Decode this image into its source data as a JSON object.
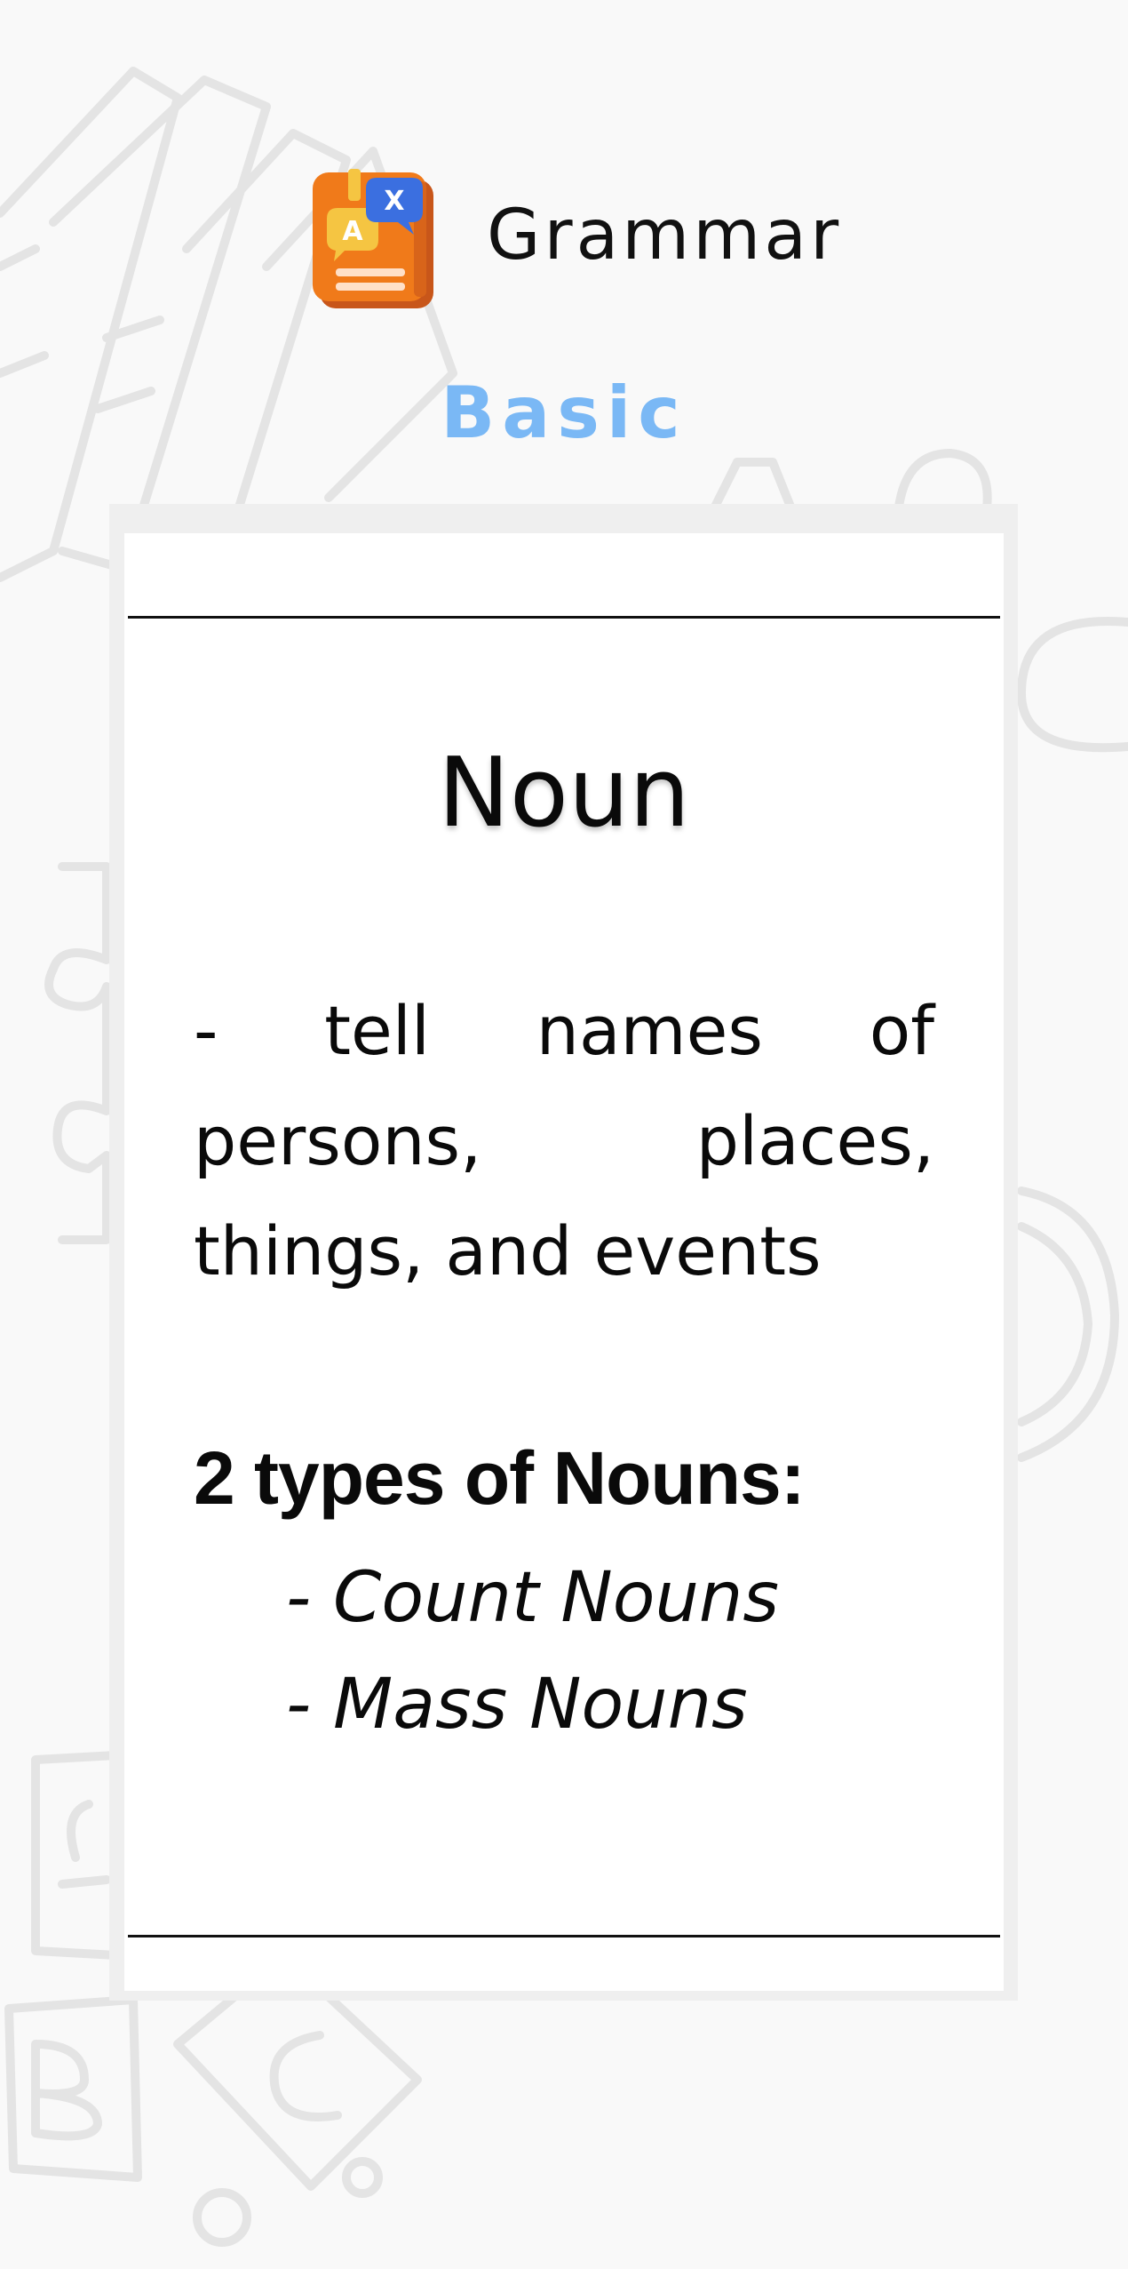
{
  "app": {
    "title": "Grammar",
    "logo_icon": "grammar-book-icon",
    "logo_letters": {
      "a": "A",
      "x": "X"
    },
    "level": "Basic"
  },
  "lesson": {
    "term": "Noun",
    "definition": "- tell names of persons, places, things, and events",
    "types_heading": "2 types of Nouns:",
    "types": [
      "- Count Nouns",
      "- Mass Nouns"
    ]
  },
  "colors": {
    "background": "#f9f9f9",
    "card": "#ffffff",
    "accent_level": "#7ab8f5",
    "logo_book": "#f07a1a",
    "logo_bubble_blue": "#3b6fe0",
    "logo_bubble_yellow": "#f5c542"
  }
}
